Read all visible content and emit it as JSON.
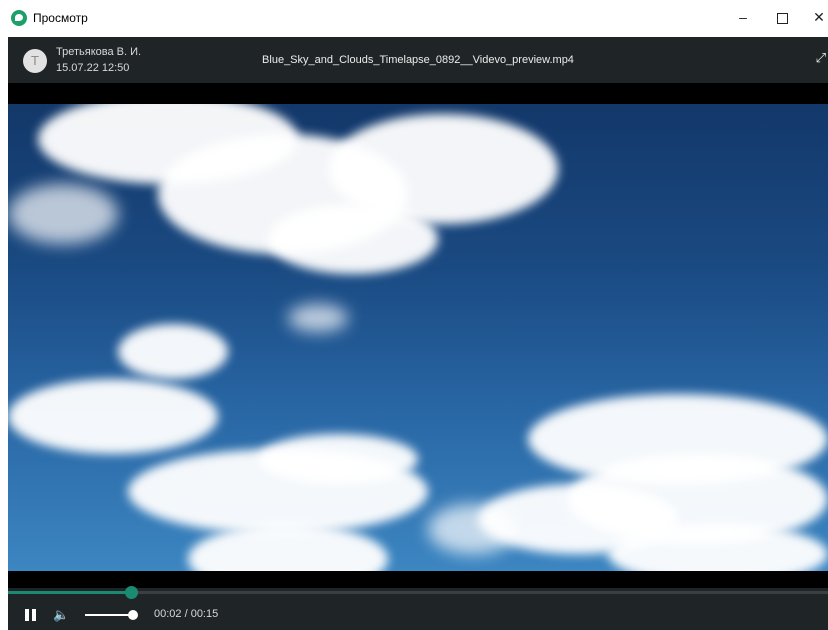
{
  "window": {
    "title": "Просмотр",
    "minimize_glyph": "–",
    "close_glyph": "✕"
  },
  "header": {
    "avatar_letter": "Т",
    "author": "Третьякова В. И.",
    "datetime": "15.07.22 12:50",
    "filename": "Blue_Sky_and_Clouds_Timelapse_0892__Videvo_preview.mp4",
    "fullscreen_glyph": "⤢"
  },
  "player": {
    "state": "playing",
    "progress_fraction": 0.15,
    "volume_fraction": 1.0,
    "current_time": "00:02",
    "total_time": "00:15",
    "time_display": "00:02 / 00:15",
    "volume_glyph": "🔈"
  },
  "colors": {
    "accent": "#1a8a73",
    "app_icon": "#1e9e6a",
    "bar_bg": "#1f2426"
  }
}
